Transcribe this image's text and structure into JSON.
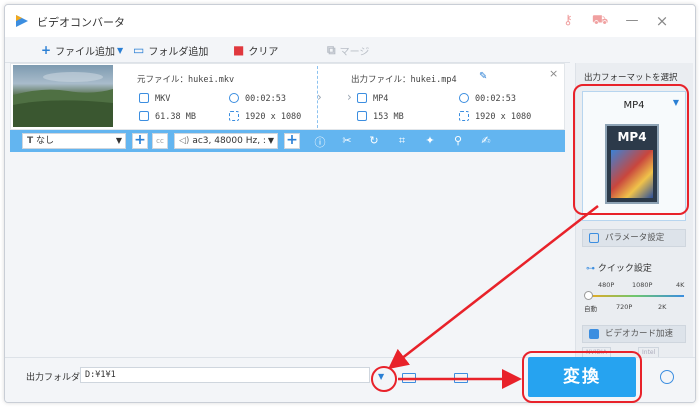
{
  "window": {
    "title": "ビデオコンバータ"
  },
  "toolbar": {
    "add_file": "ファイル追加",
    "add_folder": "フォルダ追加",
    "clear": "クリア",
    "merge": "マージ"
  },
  "file": {
    "source_label": "元ファイル：hukei.mkv",
    "output_label": "出力ファイル：hukei.mp4",
    "source": {
      "format": "MKV",
      "duration": "00:02:53",
      "size": "61.38 MB",
      "resolution": "1920 x 1080"
    },
    "output": {
      "format": "MP4",
      "duration": "00:02:53",
      "size": "153 MB",
      "resolution": "1920 x 1080"
    }
  },
  "editbar": {
    "subtitle_value": "なし",
    "audio_value": "ac3, 48000 Hz, :"
  },
  "panel": {
    "title": "出力フォーマットを選択",
    "format": "MP4",
    "format_icon_label": "MP4",
    "param_button": "パラメータ設定",
    "quick_label": "クイック設定",
    "ticks_top": [
      "480P",
      "1080P",
      "4K"
    ],
    "ticks_bottom": [
      "自動",
      "720P",
      "2K"
    ],
    "quality_level": 0,
    "hw_button": "ビデオカード加速",
    "gpu_labels": [
      "NVIDIA",
      "Intel"
    ]
  },
  "bottom": {
    "output_folder_label": "出力フォルダ：",
    "output_folder_value": "D:¥1¥1",
    "convert_label": "変換"
  },
  "colors": {
    "accent": "#26a3f0",
    "highlight": "#e8222a",
    "editbar": "#63b5f0"
  },
  "icons": [
    "app-icon",
    "plus-icon",
    "folder-icon",
    "trash-icon",
    "merge-icon",
    "edit-pen-icon",
    "close-icon",
    "clock-icon",
    "resolution-icon",
    "info-icon",
    "scissors-icon",
    "rotate-icon",
    "crop-icon",
    "effect-icon",
    "watermark-icon",
    "subtitle-edit-icon",
    "volume-icon",
    "alarm-icon"
  ]
}
